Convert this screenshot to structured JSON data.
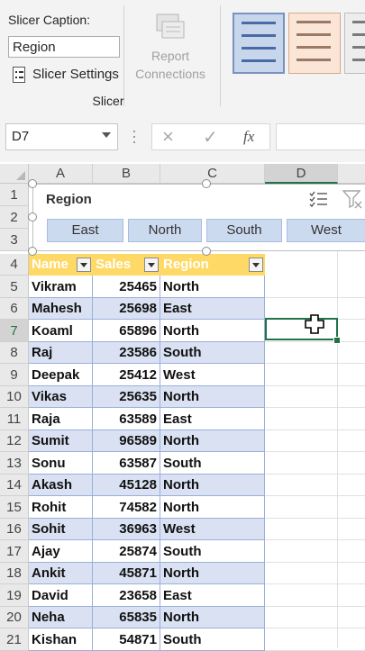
{
  "ribbon": {
    "caption_label": "Slicer Caption:",
    "caption_value": "Region",
    "settings_label": "Slicer Settings",
    "report_connections_line1": "Report",
    "report_connections_line2": "Connections",
    "group_label": "Slicer"
  },
  "formula_bar": {
    "name_box": "D7",
    "cancel_icon": "×",
    "enter_icon": "✓",
    "fx_icon": "fx",
    "formula": ""
  },
  "columns": [
    "A",
    "B",
    "C",
    "D"
  ],
  "slicer": {
    "title": "Region",
    "items": [
      "East",
      "North",
      "South",
      "West"
    ]
  },
  "table": {
    "headers": [
      "Name",
      "Sales",
      "Region"
    ],
    "rows": [
      {
        "row": "5",
        "name": "Vikram",
        "sales": "25465",
        "region": "North"
      },
      {
        "row": "6",
        "name": "Mahesh",
        "sales": "25698",
        "region": "East"
      },
      {
        "row": "7",
        "name": "Koaml",
        "sales": "65896",
        "region": "North"
      },
      {
        "row": "8",
        "name": "Raj",
        "sales": "23586",
        "region": "South"
      },
      {
        "row": "9",
        "name": "Deepak",
        "sales": "25412",
        "region": "West"
      },
      {
        "row": "10",
        "name": "Vikas",
        "sales": "25635",
        "region": "North"
      },
      {
        "row": "11",
        "name": "Raja",
        "sales": "63589",
        "region": "East"
      },
      {
        "row": "12",
        "name": "Sumit",
        "sales": "96589",
        "region": "North"
      },
      {
        "row": "13",
        "name": "Sonu",
        "sales": "63587",
        "region": "South"
      },
      {
        "row": "14",
        "name": "Akash",
        "sales": "45128",
        "region": "North"
      },
      {
        "row": "15",
        "name": "Rohit",
        "sales": "74582",
        "region": "North"
      },
      {
        "row": "16",
        "name": "Sohit",
        "sales": "36963",
        "region": "West"
      },
      {
        "row": "17",
        "name": "Ajay",
        "sales": "25874",
        "region": "South"
      },
      {
        "row": "18",
        "name": "Ankit",
        "sales": "45871",
        "region": "North"
      },
      {
        "row": "19",
        "name": "David",
        "sales": "23658",
        "region": "East"
      },
      {
        "row": "20",
        "name": "Neha",
        "sales": "65835",
        "region": "North"
      },
      {
        "row": "21",
        "name": "Kishan",
        "sales": "54871",
        "region": "South"
      }
    ]
  },
  "top_rows": [
    "1",
    "2",
    "3",
    "4"
  ],
  "colors": {
    "header_fill": "#ffd966",
    "band_fill": "#d9e1f2",
    "slicer_button": "#ccdaf0",
    "selection": "#217346"
  }
}
